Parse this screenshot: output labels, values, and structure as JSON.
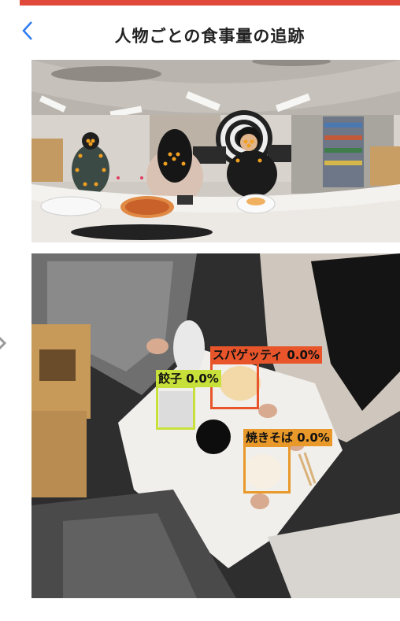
{
  "header": {
    "back_icon": "chevron-left-icon",
    "title": "人物ごとの食事量の追跡"
  },
  "detections": [
    {
      "label": "スパゲッティ 0.0%",
      "color": "#e8552a"
    },
    {
      "label": "餃子 0.0%",
      "color": "#c8e03a"
    },
    {
      "label": "焼きそば 0.0%",
      "color": "#e8992a"
    }
  ],
  "colors": {
    "accent_bar": "#e0483a",
    "back_icon": "#2f7cf6",
    "keypoint": "#f0a020"
  }
}
